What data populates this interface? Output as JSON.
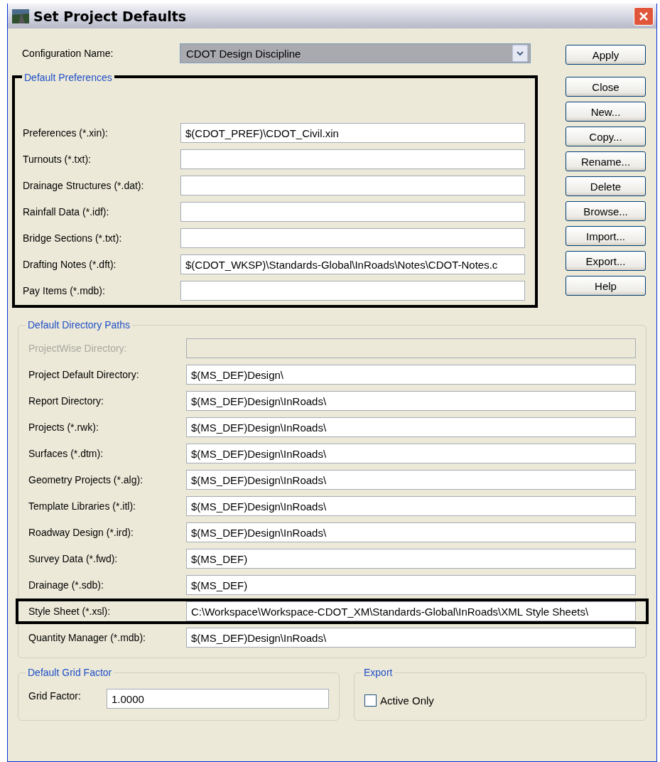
{
  "window": {
    "title": "Set Project Defaults"
  },
  "configuration": {
    "label": "Configuration Name:",
    "value": "CDOT Design Discipline"
  },
  "default_preferences": {
    "title": "Default Preferences",
    "highlighted": true,
    "rows": [
      {
        "label": "Preferences (*.xin):",
        "value": "$(CDOT_PREF)\\CDOT_Civil.xin"
      },
      {
        "label": "Turnouts (*.txt):",
        "value": ""
      },
      {
        "label": "Drainage Structures (*.dat):",
        "value": ""
      },
      {
        "label": "Rainfall Data (*.idf):",
        "value": ""
      },
      {
        "label": "Bridge Sections (*.txt):",
        "value": ""
      },
      {
        "label": "Drafting Notes (*.dft):",
        "value": "$(CDOT_WKSP)\\Standards-Global\\InRoads\\Notes\\CDOT-Notes.c"
      },
      {
        "label": "Pay Items (*.mdb):",
        "value": ""
      }
    ]
  },
  "buttons": [
    "Apply",
    "Close",
    "New...",
    "Copy...",
    "Rename...",
    "Delete",
    "Browse...",
    "Import...",
    "Export...",
    "Help"
  ],
  "default_directory_paths": {
    "title": "Default Directory Paths",
    "rows": [
      {
        "label": "ProjectWise Directory:",
        "value": "",
        "disabled": true,
        "highlighted": false
      },
      {
        "label": "Project Default Directory:",
        "value": "$(MS_DEF)Design\\",
        "disabled": false,
        "highlighted": false
      },
      {
        "label": "Report Directory:",
        "value": "$(MS_DEF)Design\\InRoads\\",
        "disabled": false,
        "highlighted": false
      },
      {
        "label": "Projects (*.rwk):",
        "value": "$(MS_DEF)Design\\InRoads\\",
        "disabled": false,
        "highlighted": false
      },
      {
        "label": "Surfaces (*.dtm):",
        "value": "$(MS_DEF)Design\\InRoads\\",
        "disabled": false,
        "highlighted": false
      },
      {
        "label": "Geometry Projects (*.alg):",
        "value": "$(MS_DEF)Design\\InRoads\\",
        "disabled": false,
        "highlighted": false
      },
      {
        "label": "Template Libraries (*.itl):",
        "value": "$(MS_DEF)Design\\InRoads\\",
        "disabled": false,
        "highlighted": false
      },
      {
        "label": "Roadway Design (*.ird):",
        "value": "$(MS_DEF)Design\\InRoads\\",
        "disabled": false,
        "highlighted": false
      },
      {
        "label": "Survey Data (*.fwd):",
        "value": "$(MS_DEF)",
        "disabled": false,
        "highlighted": false
      },
      {
        "label": "Drainage (*.sdb):",
        "value": "$(MS_DEF)",
        "disabled": false,
        "highlighted": false
      },
      {
        "label": "Style Sheet (*.xsl):",
        "value": "C:\\Workspace\\Workspace-CDOT_XM\\Standards-Global\\InRoads\\XML Style Sheets\\",
        "disabled": false,
        "highlighted": true
      },
      {
        "label": "Quantity Manager (*.mdb):",
        "value": "$(MS_DEF)Design\\InRoads\\",
        "disabled": false,
        "highlighted": false
      }
    ]
  },
  "default_grid_factor": {
    "title": "Default Grid Factor",
    "label": "Grid Factor:",
    "value": "1.0000"
  },
  "export": {
    "title": "Export",
    "checkbox": {
      "label": "Active Only",
      "checked": false
    }
  }
}
